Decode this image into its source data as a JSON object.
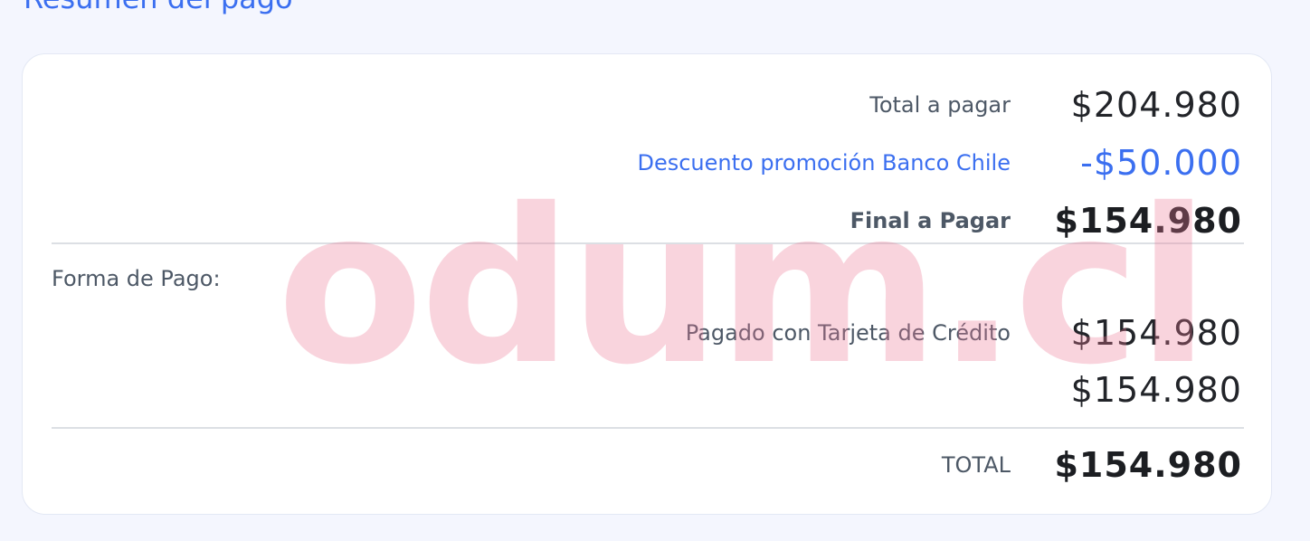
{
  "section_title": "Resumen del pago",
  "summary": {
    "total_label": "Total a pagar",
    "total_amount": "$204.980",
    "discount_label": "Descuento promoción Banco Chile",
    "discount_amount": "-$50.000",
    "final_label": "Final a Pagar",
    "final_amount": "$154.980"
  },
  "payment": {
    "section_label": "Forma de Pago:",
    "method_label": "Pagado con Tarjeta de Crédito",
    "method_amount": "$154.980",
    "subtotal_amount": "$154.980"
  },
  "total": {
    "label": "TOTAL",
    "amount": "$154.980"
  },
  "watermark": "odum.cl",
  "colors": {
    "accent": "#3b6ff0",
    "background": "#f4f6fe",
    "card": "#ffffff",
    "watermark": "#f5c9d4"
  }
}
